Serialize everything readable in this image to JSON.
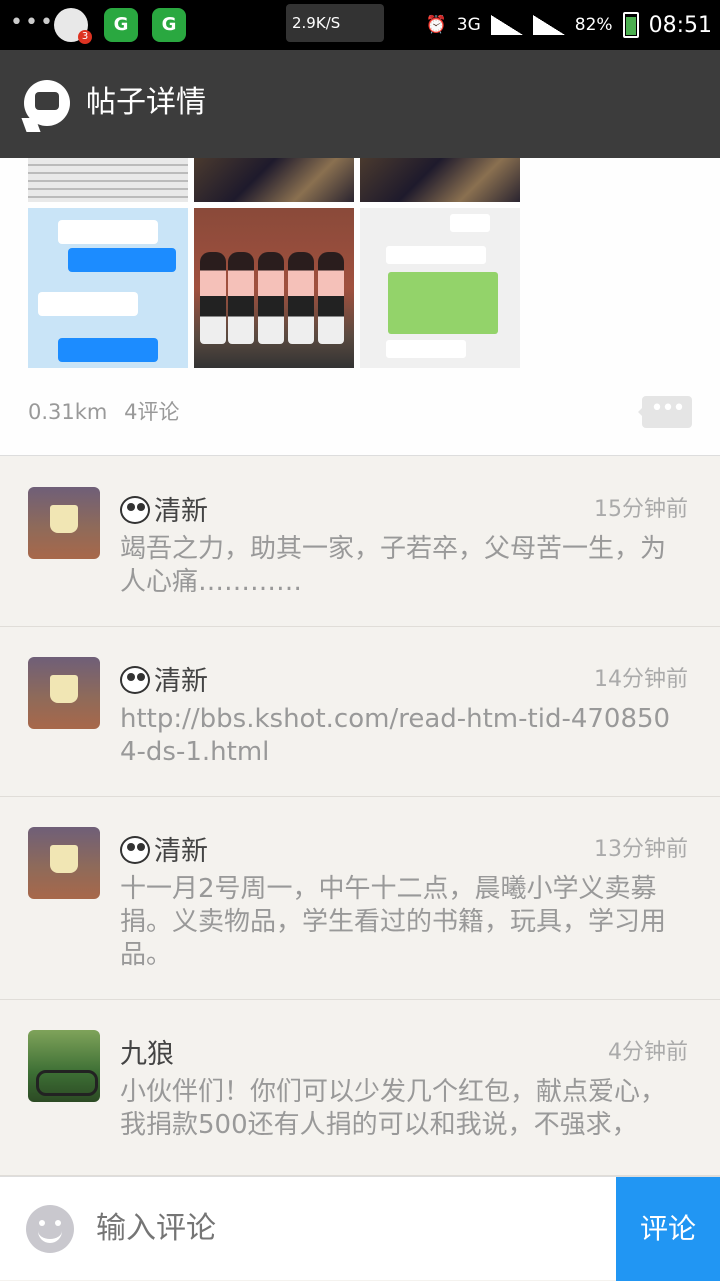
{
  "status_bar": {
    "speed": "2.9K/S",
    "network": "3G",
    "battery": "82%",
    "time": "08:51"
  },
  "header": {
    "title": "帖子详情",
    "logo_icon": "chat-bubble-icon"
  },
  "post": {
    "distance": "0.31km",
    "comment_count": "4评论",
    "more_icon": "more-dots-icon"
  },
  "comments": [
    {
      "user": "清新",
      "time": "15分钟前",
      "text": "竭吾之力，助其一家，子若卒，父母苦一生，为人心痛…………"
    },
    {
      "user": "清新",
      "time": "14分钟前",
      "text": "http://bbs.kshot.com/read-htm-tid-4708504-ds-1.html"
    },
    {
      "user": "清新",
      "time": "13分钟前",
      "text": "十一月2号周一，中午十二点，晨曦小学义卖募捐。义卖物品，学生看过的书籍，玩具，学习用品。"
    },
    {
      "user": "九狼",
      "time": "4分钟前",
      "text": "小伙伴们！你们可以少发几个红包，献点爱心，我捐款500还有人捐的可以和我说，不强求，"
    }
  ],
  "comment_bar": {
    "placeholder": "输入评论",
    "send_label": "评论"
  }
}
